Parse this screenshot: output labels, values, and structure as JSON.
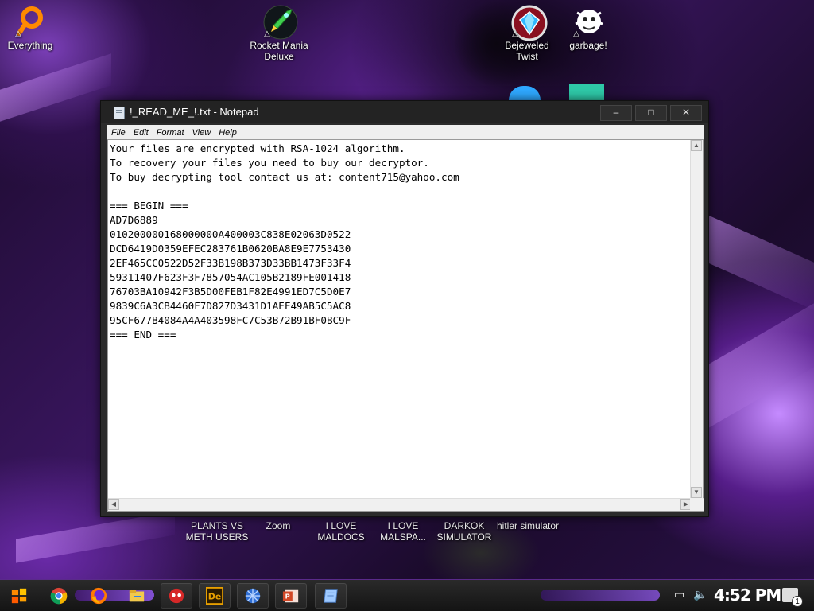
{
  "desktop": {
    "icons": [
      {
        "label": "Everything",
        "icon": "magnifier-icon"
      },
      {
        "label": "Rocket Mania Deluxe",
        "icon": "rocket-icon"
      },
      {
        "label": "Bejeweled Twist",
        "icon": "gem-icon"
      },
      {
        "label": "garbage!",
        "icon": "creature-icon"
      }
    ],
    "lower_labels": [
      {
        "line1": "PLANTS VS",
        "line2": "METH USERS"
      },
      {
        "line1": "Zoom",
        "line2": ""
      },
      {
        "line1": "I LOVE",
        "line2": "MALDOCS"
      },
      {
        "line1": "I LOVE",
        "line2": "MALSPA..."
      },
      {
        "line1": "DARKOK",
        "line2": "SIMULATOR"
      },
      {
        "line1": "hitler simulator",
        "line2": ""
      }
    ]
  },
  "notepad": {
    "title": "!_READ_ME_!.txt - Notepad",
    "controls": {
      "minimize": "–",
      "maximize": "□",
      "close": "✕"
    },
    "menu": [
      "File",
      "Edit",
      "Format",
      "View",
      "Help"
    ],
    "content": "Your files are encrypted with RSA-1024 algorithm.\nTo recovery your files you need to buy our decryptor.\nTo buy decrypting tool contact us at: content715@yahoo.com\n\n=== BEGIN ===\nAD7D6889\n010200000168000000A400003C838E02063D0522\nDCD6419D0359EFEC283761B0620BA8E9E7753430\n2EF465CC0522D52F33B198B373D33BB1473F33F4\n59311407F623F3F7857054AC105B2189FE001418\n76703BA10942F3B5D00FEB1F82E4991ED7C5D0E7\n9839C6A3CB4460F7D827D3431D1AEF49AB5C5AC8\n95CF677B4084A4A403598FC7C53B72B91BF0BC9F\n=== END ==="
  },
  "taskbar": {
    "apps": [
      {
        "name": "start-button",
        "icon": "start-icon",
        "color": "#ff8a00"
      },
      {
        "name": "chrome-button",
        "icon": "chrome-icon",
        "color": "#db4437"
      },
      {
        "name": "firefox-button",
        "icon": "firefox-icon",
        "color": "#ff7a00"
      },
      {
        "name": "file-explorer-button",
        "icon": "folder-icon",
        "color": "#f2c94c"
      },
      {
        "name": "app-red-button",
        "icon": "red-face-icon",
        "color": "#d62828"
      },
      {
        "name": "app-de-button",
        "icon": "de-icon",
        "color": "#e8a000"
      },
      {
        "name": "app-globe-button",
        "icon": "globe-icon",
        "color": "#2f6fd6"
      },
      {
        "name": "powerpoint-button",
        "icon": "powerpoint-icon",
        "color": "#d24726"
      },
      {
        "name": "notepad-taskbar-button",
        "icon": "notepad-icon",
        "color": "#9ec9ff"
      }
    ],
    "clock": "4:52 PM",
    "notification_count": "1"
  }
}
